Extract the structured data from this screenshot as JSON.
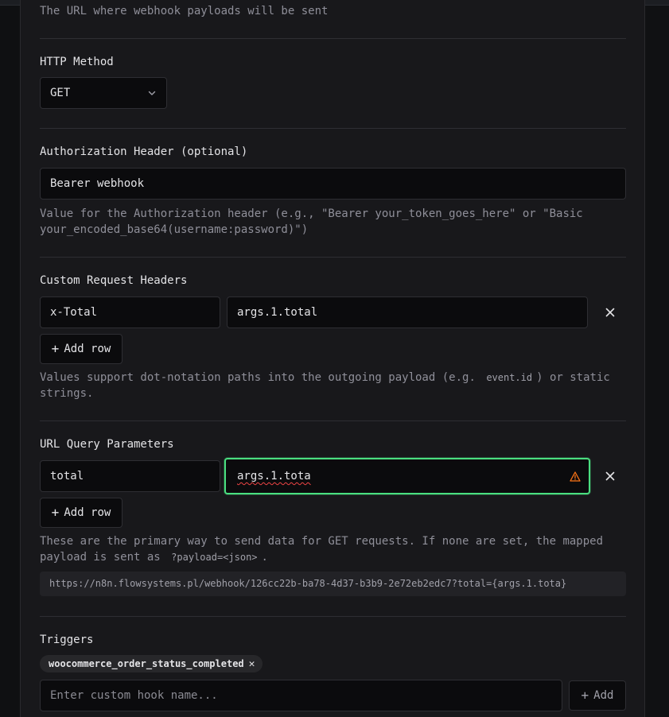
{
  "url_field": {
    "help": "The URL where webhook payloads will be sent"
  },
  "http_method": {
    "label": "HTTP Method",
    "value": "GET"
  },
  "authorization": {
    "label": "Authorization Header (optional)",
    "value": "Bearer webhook",
    "help": "Value for the Authorization header (e.g., \"Bearer your_token_goes_here\" or \"Basic your_encoded_base64(username:password)\")"
  },
  "custom_headers": {
    "label": "Custom Request Headers",
    "rows": [
      {
        "key": "x-Total",
        "value": "args.1.total"
      }
    ],
    "add_row_label": "Add row",
    "help_before": "Values support dot-notation paths into the outgoing payload (e.g.",
    "help_code": "event.id",
    "help_after": ") or static strings."
  },
  "query_params": {
    "label": "URL Query Parameters",
    "rows": [
      {
        "key": "total",
        "value": "args.1.tota"
      }
    ],
    "add_row_label": "Add row",
    "help_before": "These are the primary way to send data for GET requests. If none are set, the mapped payload is sent as",
    "help_code": "?payload=<json>",
    "help_after": ".",
    "preview_url": "https://n8n.flowsystems.pl/webhook/126cc22b-ba78-4d37-b3b9-2e72eb2edc7?total={args.1.tota}"
  },
  "triggers": {
    "label": "Triggers",
    "chips": [
      "woocommerce_order_status_completed"
    ],
    "input_placeholder": "Enter custom hook name...",
    "add_label": "Add"
  },
  "colors": {
    "focus_ring": "#4ade80",
    "warning": "#f97316",
    "background": "#18181b"
  },
  "icons": {
    "select_chevron": "chevron-down-icon",
    "remove_row": "close-icon",
    "warning": "warning-triangle-icon",
    "add": "plus-icon"
  }
}
